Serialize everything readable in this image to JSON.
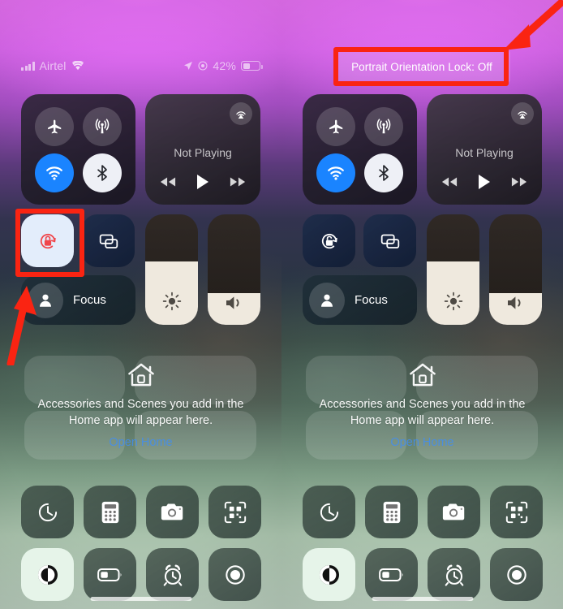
{
  "panels": [
    {
      "id": "before",
      "status_bar": {
        "carrier": "Airtel",
        "signal_icon": "cellular-signal-icon",
        "wifi_icon": "wifi-icon",
        "location_icon": "location-arrow-icon",
        "focus_icon": "focus-indicator-icon",
        "battery_percent": "42%",
        "battery_icon": "battery-icon"
      },
      "toast": null,
      "connectivity": {
        "airplane": {
          "label": "Airplane Mode",
          "icon": "airplane-icon",
          "state": "off"
        },
        "cellular": {
          "label": "Cellular Data",
          "icon": "cellular-tower-icon",
          "state": "off"
        },
        "wifi": {
          "label": "Wi-Fi",
          "icon": "wifi-icon",
          "state": "on"
        },
        "bluetooth": {
          "label": "Bluetooth",
          "icon": "bluetooth-icon",
          "state": "on"
        }
      },
      "media": {
        "airplay_icon": "airplay-audio-icon",
        "status": "Not Playing",
        "rewind_icon": "rewind-icon",
        "play_icon": "play-icon",
        "forward_icon": "fast-forward-icon"
      },
      "orientation_lock": {
        "label": "Portrait Orientation Lock",
        "icon": "rotation-lock-locked-icon",
        "state": "on"
      },
      "screen_mirroring": {
        "label": "Screen Mirroring",
        "icon": "screen-mirroring-icon"
      },
      "focus": {
        "label": "Focus",
        "icon": "focus-person-icon"
      },
      "brightness": {
        "label": "Brightness",
        "icon": "brightness-sun-icon",
        "value": 57
      },
      "volume": {
        "label": "Volume",
        "icon": "volume-speaker-icon",
        "value": 29
      },
      "home_section": {
        "icon": "home-house-icon",
        "text": "Accessories and Scenes you add in the Home app will appear here.",
        "link": "Open Home"
      },
      "tiles": [
        {
          "label": "Timer",
          "icon": "timer-icon",
          "state": "off"
        },
        {
          "label": "Calculator",
          "icon": "calculator-icon",
          "state": "off"
        },
        {
          "label": "Camera",
          "icon": "camera-icon",
          "state": "off"
        },
        {
          "label": "Code Scanner",
          "icon": "qr-scanner-icon",
          "state": "off"
        },
        {
          "label": "Dark Mode",
          "icon": "dark-mode-icon",
          "state": "on"
        },
        {
          "label": "Low Power Mode",
          "icon": "low-power-battery-icon",
          "state": "off"
        },
        {
          "label": "Alarm",
          "icon": "alarm-clock-icon",
          "state": "off"
        },
        {
          "label": "Screen Recording",
          "icon": "screen-record-icon",
          "state": "off"
        }
      ]
    },
    {
      "id": "after",
      "status_bar": null,
      "toast": {
        "text": "Portrait Orientation Lock: Off"
      },
      "connectivity": {
        "airplane": {
          "label": "Airplane Mode",
          "icon": "airplane-icon",
          "state": "off"
        },
        "cellular": {
          "label": "Cellular Data",
          "icon": "cellular-tower-icon",
          "state": "off"
        },
        "wifi": {
          "label": "Wi-Fi",
          "icon": "wifi-icon",
          "state": "on"
        },
        "bluetooth": {
          "label": "Bluetooth",
          "icon": "bluetooth-icon",
          "state": "on"
        }
      },
      "media": {
        "airplay_icon": "airplay-audio-icon",
        "status": "Not Playing",
        "rewind_icon": "rewind-icon",
        "play_icon": "play-icon",
        "forward_icon": "fast-forward-icon"
      },
      "orientation_lock": {
        "label": "Portrait Orientation Lock",
        "icon": "rotation-lock-unlocked-icon",
        "state": "off"
      },
      "screen_mirroring": {
        "label": "Screen Mirroring",
        "icon": "screen-mirroring-icon"
      },
      "focus": {
        "label": "Focus",
        "icon": "focus-person-icon"
      },
      "brightness": {
        "label": "Brightness",
        "icon": "brightness-sun-icon",
        "value": 57
      },
      "volume": {
        "label": "Volume",
        "icon": "volume-speaker-icon",
        "value": 29
      },
      "home_section": {
        "icon": "home-house-icon",
        "text": "Accessories and Scenes you add in the Home app will appear here.",
        "link": "Open Home"
      },
      "tiles": [
        {
          "label": "Timer",
          "icon": "timer-icon",
          "state": "off"
        },
        {
          "label": "Calculator",
          "icon": "calculator-icon",
          "state": "off"
        },
        {
          "label": "Camera",
          "icon": "camera-icon",
          "state": "off"
        },
        {
          "label": "Code Scanner",
          "icon": "qr-scanner-icon",
          "state": "off"
        },
        {
          "label": "Dark Mode",
          "icon": "dark-mode-icon",
          "state": "on"
        },
        {
          "label": "Low Power Mode",
          "icon": "low-power-battery-icon",
          "state": "off"
        },
        {
          "label": "Alarm",
          "icon": "alarm-clock-icon",
          "state": "off"
        },
        {
          "label": "Screen Recording",
          "icon": "screen-record-icon",
          "state": "off"
        }
      ]
    }
  ],
  "annotations": {
    "color": "#fa2412",
    "highlight_left": {
      "target": "orientation-lock-button-left"
    },
    "highlight_right": {
      "target": "portrait-orientation-lock-toast"
    },
    "arrow_left": {
      "target": "orientation-lock-button-left",
      "direction": "up-right"
    },
    "arrow_right": {
      "target": "portrait-orientation-lock-toast",
      "direction": "down-left"
    }
  }
}
